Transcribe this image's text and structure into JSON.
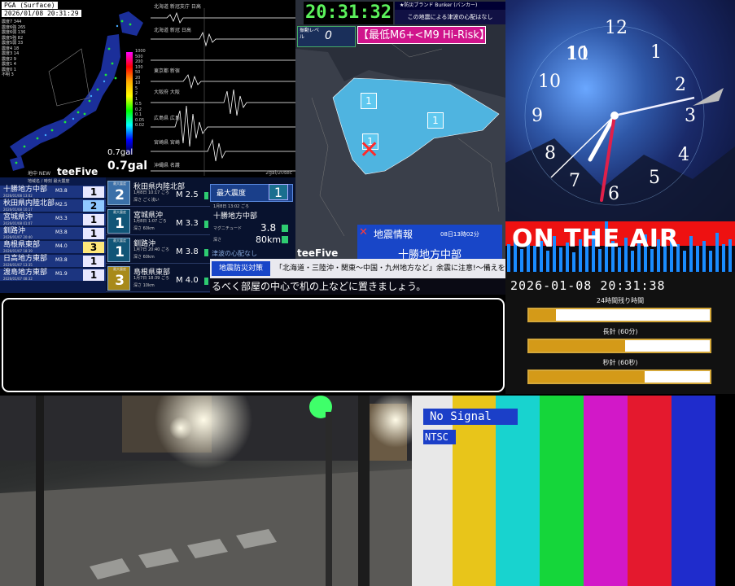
{
  "pga": {
    "title": "PGA (Surface)",
    "timestamp": "2026/01/08 20:31:29",
    "stats": [
      "震度7 344",
      "震度6強 265",
      "震度6弱 136",
      "震度5強 82",
      "震度5弱 33",
      "震度4 18",
      "震度3 14",
      "震度2 9",
      "震度1 4",
      "震度0 1",
      "不明 3"
    ],
    "scale_labels": [
      "1000",
      "500",
      "200",
      "100",
      "50",
      "20",
      "10",
      "5",
      "2",
      "1",
      "0.5",
      "0.2",
      "0.1",
      "0.05",
      "0.02"
    ],
    "gal_label": "0.7gal",
    "gal_value": "0.7gal",
    "footer": "地中 NEW",
    "brand": "teeFive"
  },
  "waveforms": {
    "stations": [
      "北海道 新冠支庁 日高",
      "北海道 新冠 日高",
      "東京都 新宿",
      "大阪府 大阪",
      "広島県 広島",
      "宮崎県 宮崎",
      "沖縄県 名護"
    ],
    "unit": "2gal/20sec"
  },
  "eew": {
    "clock": "20:31:32",
    "bunker": "★防災ブランド Bunker (バンカー)",
    "tsunami_note": "この地震による津波の心配はなし",
    "level_label": "振動レベル",
    "level_value": "0",
    "risk": "【最低M6+<M9 Hi-Risk】",
    "map_intensities": [
      "1",
      "1",
      "1"
    ],
    "quake_title": "地震情報",
    "quake_time": "08日13時02分",
    "quake_area": "十勝地方中部",
    "brand": "teeFive"
  },
  "intensity_list": {
    "header": "地域名 / 時刻   最大震度",
    "rows": [
      {
        "name": "十勝地方中部",
        "date": "2026/01/08 13:02",
        "mag": "M3.8",
        "level": "1",
        "color": "#e8e8ff"
      },
      {
        "name": "秋田県内陸北部",
        "date": "2026/01/08 10:17",
        "mag": "M2.5",
        "level": "2",
        "color": "#8fc8ff"
      },
      {
        "name": "宮城県沖",
        "date": "2026/01/08 01:07",
        "mag": "M3.3",
        "level": "1",
        "color": "#e8e8ff"
      },
      {
        "name": "釧路沖",
        "date": "2026/01/07 20:40",
        "mag": "M3.8",
        "level": "1",
        "color": "#e8e8ff"
      },
      {
        "name": "島根県東部",
        "date": "2026/01/07 18:39",
        "mag": "M4.0",
        "level": "3",
        "color": "#ffe87a"
      },
      {
        "name": "日高地方東部",
        "date": "2026/01/07 13:35",
        "mag": "M3.8",
        "level": "1",
        "color": "#e8e8ff"
      },
      {
        "name": "渡島地方東部",
        "date": "2026/01/07 08:32",
        "mag": "M1.9",
        "level": "1",
        "color": "#e8e8ff"
      }
    ]
  },
  "detail_list": {
    "rows": [
      {
        "scale": "最大震度",
        "level": "2",
        "name": "秋田県内陸北部",
        "date": "1月8日 10:17 ごろ",
        "depth": "深さ ごく浅い",
        "mag": "M 2.5"
      },
      {
        "scale": "最大震度",
        "level": "1",
        "name": "宮城県沖",
        "date": "1月8日 1:07 ごろ",
        "depth": "深さ 60km",
        "mag": "M 3.3"
      },
      {
        "scale": "最大震度",
        "level": "1",
        "name": "釧路沖",
        "date": "1月7日 20:40 ごろ",
        "depth": "深さ 60km",
        "mag": "M 3.8"
      },
      {
        "scale": "最大震度",
        "level": "3",
        "name": "島根県東部",
        "date": "1月7日 18:39 ごろ",
        "depth": "深さ 10km",
        "mag": "M 4.0"
      }
    ]
  },
  "max_intensity": {
    "label": "最大震度",
    "value": "1",
    "date": "1月8日 13:02 ごろ",
    "area": "十勝地方中部",
    "mag_label": "マグニチュード",
    "mag_value": "3.8",
    "depth_label": "深さ",
    "depth_value": "80km",
    "tsunami": "津波の心配なし"
  },
  "ticker": {
    "tag": "地震防災対策",
    "message": "「北海道・三陸沖・関東〜中国・九州地方など」余震に注意!〜備えを〜",
    "scroll": "るべく部屋の中心で机の上などに置きましょう。"
  },
  "clock_panel": {
    "numbers": [
      "12",
      "1",
      "2",
      "3",
      "4",
      "5",
      "6",
      "7",
      "8",
      "9",
      "10",
      "11"
    ]
  },
  "onair": {
    "text": "ON THE AIR",
    "datetime": "2026-01-08 20:31:38",
    "remaining_label": "24時間残り時間",
    "long_hand_label": "長針 (60分)",
    "second_hand_label": "秒針 (60秒)",
    "day_progress": 0.15,
    "minute_progress": 0.53,
    "second_progress": 0.64
  },
  "testcard": {
    "no_signal": "No Signal",
    "standard": "NTSC",
    "colors": [
      "#e8e8e8",
      "#e8c51a",
      "#18d3cf",
      "#15d63a",
      "#d218c8",
      "#e4192e",
      "#1f2ccc",
      "#000000"
    ]
  }
}
